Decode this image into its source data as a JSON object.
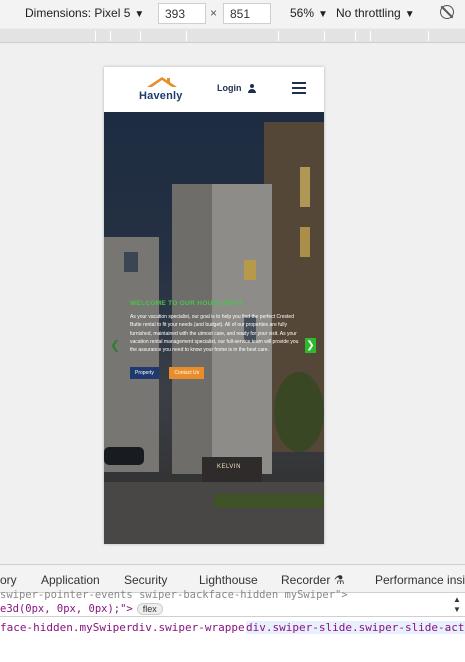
{
  "device_toolbar": {
    "dimensions_label": "Dimensions: Pixel 5",
    "width_value": "393",
    "times": "×",
    "height_value": "851",
    "zoom": "56%",
    "throttling": "No throttling",
    "caret": "▼"
  },
  "site": {
    "logo_text": "Havenly",
    "login_label": "Login",
    "colors": {
      "brand_blue": "#1e3a6e",
      "accent_orange": "#e88d2a",
      "accent_green": "#4cc24c"
    }
  },
  "hero": {
    "title": "WELCOME TO OUR HOUSE RENT",
    "body": "As your vacation specialist, our goal is to help you find the perfect Crested Butte rental to fit your needs (and budget). All of our properties are fully furnished, maintained with the utmost care, and ready for your visit. As your vacation rental management specialist, our full-service team will provide you the assurance you need to know your home is in the best care.",
    "btn_property": "Property",
    "btn_contact": "Contact Us",
    "sign_text": "KELVIN"
  },
  "devtools": {
    "tabs": [
      "ory",
      "Application",
      "Security",
      "Lighthouse",
      "Recorder",
      "Performance insi"
    ],
    "code_line_1": "swiper-pointer-events swiper-backface-hidden mySwiper\">",
    "code_line_2": "e3d(0px, 0px, 0px);\">",
    "flex_badge": "flex",
    "breadcrumbs": [
      "face-hidden.mySwiper",
      "div.swiper-wrapper",
      "div.swiper-slide.swiper-slide-active"
    ],
    "more": "..."
  }
}
